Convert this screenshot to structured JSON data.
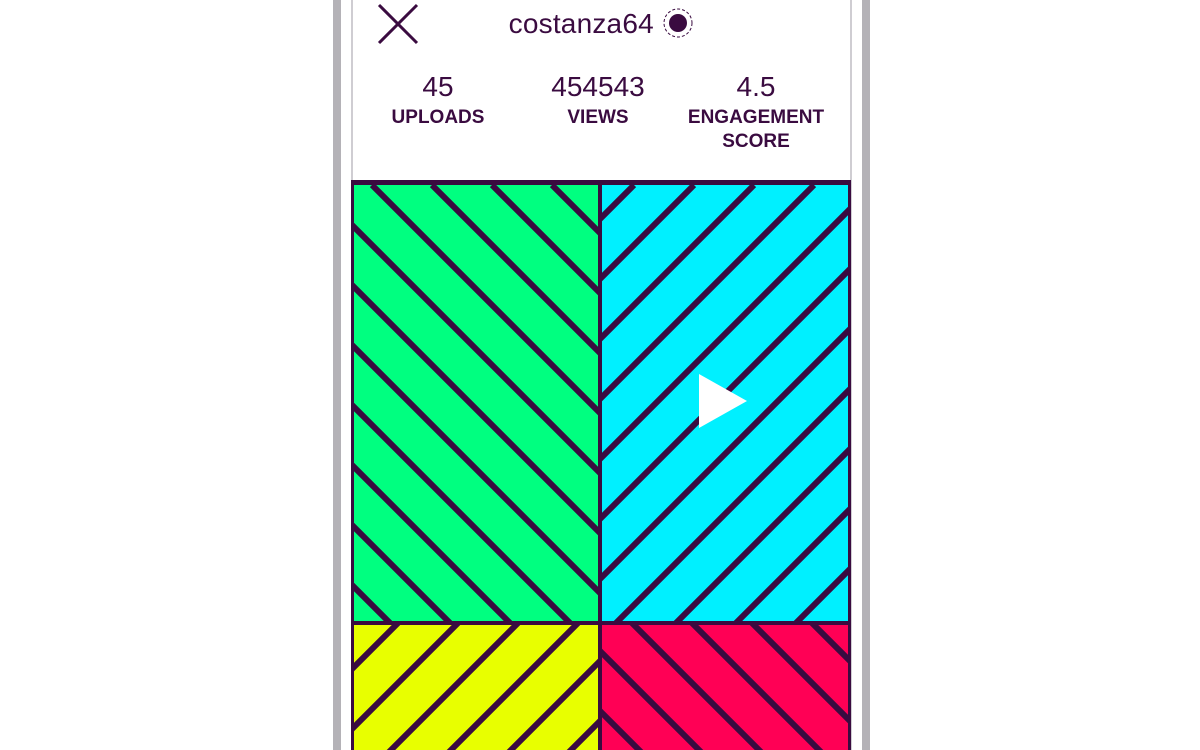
{
  "profile": {
    "username": "costanza64",
    "status_icon": "online-status-icon"
  },
  "stats": {
    "uploads_value": "45",
    "uploads_label": "UPLOADS",
    "views_value": "454543",
    "views_label": "VIEWS",
    "engagement_value": "4.5",
    "engagement_label_line1": "ENGAGEMENT",
    "engagement_label_line2": "SCORE"
  },
  "tiles": [
    {
      "color": "#00ff80",
      "pattern": "stripes-down-right"
    },
    {
      "color": "#00f0ff",
      "pattern": "stripes-up-right"
    },
    {
      "color": "#e8ff00",
      "pattern": "stripes-up-right"
    },
    {
      "color": "#ff0055",
      "pattern": "stripes-down-right"
    }
  ],
  "colors": {
    "ink": "#3a0b40",
    "frame": "#b4b2b7",
    "play": "#ffffff"
  }
}
